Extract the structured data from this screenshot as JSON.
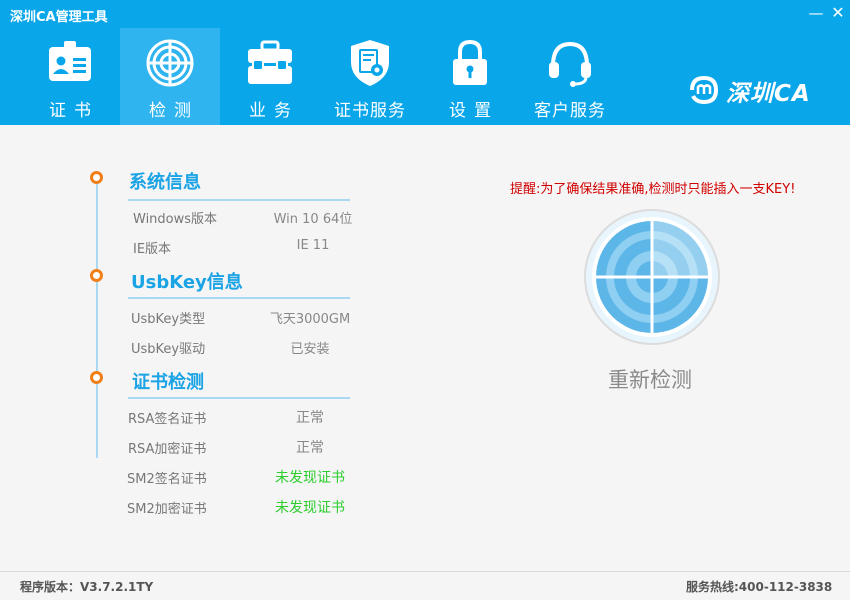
{
  "window": {
    "title": "深圳CA管理工具",
    "minimize": "—",
    "close": "✕"
  },
  "nav": {
    "items": [
      {
        "label": "证书",
        "icon": "id-card-icon"
      },
      {
        "label": "检测",
        "icon": "radar-icon"
      },
      {
        "label": "业务",
        "icon": "briefcase-icon"
      },
      {
        "label": "证书服务",
        "icon": "certificate-shield-icon"
      },
      {
        "label": "设置",
        "icon": "lock-icon"
      },
      {
        "label": "客户服务",
        "icon": "headset-icon"
      }
    ],
    "active": "检测"
  },
  "brand": {
    "text": "深圳CA"
  },
  "system": {
    "title": "系统信息",
    "rows": [
      {
        "label": "Windows版本",
        "value": "Win 10 64位"
      },
      {
        "label": "IE版本",
        "value": "IE 11"
      }
    ]
  },
  "usbkey": {
    "title": "UsbKey信息",
    "rows": [
      {
        "label": "UsbKey类型",
        "value": "飞天3000GM"
      },
      {
        "label": "UsbKey驱动",
        "value": "已安装"
      }
    ]
  },
  "cert": {
    "title": "证书检测",
    "rows": [
      {
        "label": "RSA签名证书",
        "value": "正常",
        "status": "ok"
      },
      {
        "label": "RSA加密证书",
        "value": "正常",
        "status": "ok"
      },
      {
        "label": "SM2签名证书",
        "value": "未发现证书",
        "status": "warn"
      },
      {
        "label": "SM2加密证书",
        "value": "未发现证书",
        "status": "warn"
      }
    ]
  },
  "detect": {
    "reminder": "提醒:为了确保结果准确,检测时只能插入一支KEY!",
    "button": "重新检测"
  },
  "footer": {
    "version": "程序版本：V3.7.2.1TY",
    "hotline": "服务热线:400-112-3838"
  },
  "colors": {
    "header": "#0aa6ea",
    "active_tab": "#2fb4ef",
    "section_title": "#1aa3e5",
    "dot": "#f07f17",
    "reminder": "#d10000",
    "warn": "#2ccd2c"
  }
}
